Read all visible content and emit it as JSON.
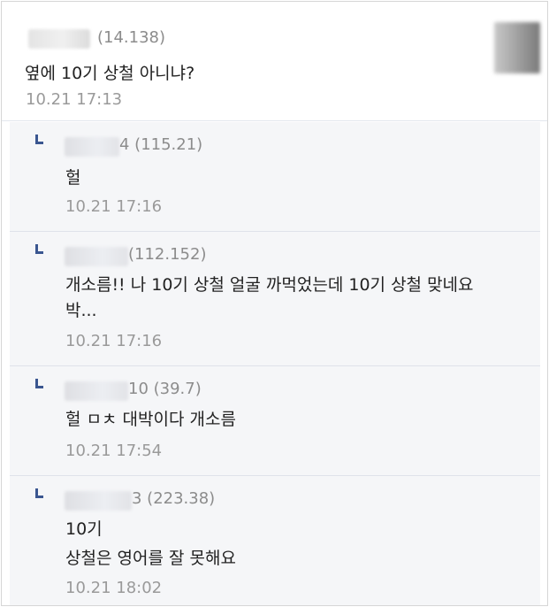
{
  "comment": {
    "ip": "(14.138)",
    "text": "옆에 10기 상철 아니냐?",
    "time": "10.21 17:13"
  },
  "replies": [
    {
      "ip": "4 (115.21)",
      "text": "헐",
      "time": "10.21 17:16"
    },
    {
      "ip": "(112.152)",
      "text_line1": "개소름!! 나 10기 상철 얼굴 까먹었는데 10기 상철 맞네요",
      "text_line2": "박...",
      "time": "10.21 17:16"
    },
    {
      "ip": "10 (39.7)",
      "text": "헐 ㅁㅊ 대박이다 개소름",
      "time": "10.21 17:54"
    },
    {
      "ip": "3 (223.38)",
      "text_line1": "10기",
      "text_line2": "상철은 영어를 잘 못해요",
      "time": "10.21 18:02"
    }
  ]
}
